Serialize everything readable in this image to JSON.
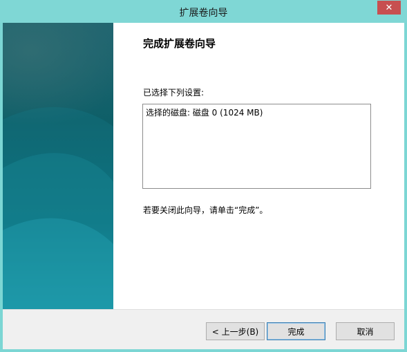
{
  "window": {
    "title": "扩展卷向导",
    "close_glyph": "✕"
  },
  "page": {
    "heading": "完成扩展卷向导",
    "selection_label": "已选择下列设置:",
    "summary_line": "选择的磁盘: 磁盘 0 (1024 MB)",
    "close_hint": "若要关闭此向导，请单击“完成”。"
  },
  "buttons": {
    "back": "< 上一步(B)",
    "finish": "完成",
    "cancel": "取消"
  },
  "colors": {
    "title_bar": "#7fd7d5",
    "side_panel": "#0e5f68",
    "close_button": "#c74f50"
  }
}
